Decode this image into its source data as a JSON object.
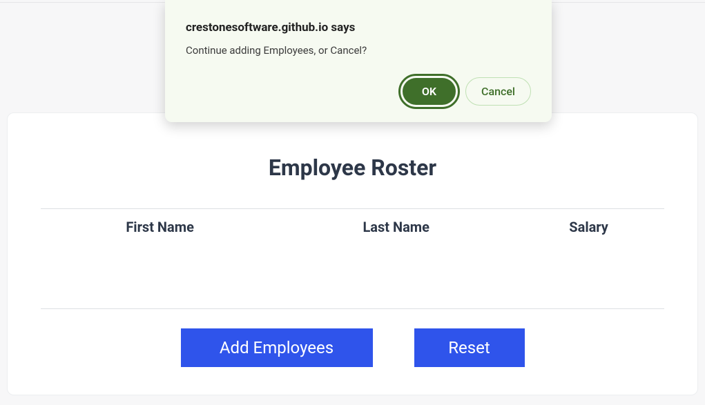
{
  "dialog": {
    "title": "crestonesoftware.github.io says",
    "message": "Continue adding Employees, or Cancel?",
    "ok_label": "OK",
    "cancel_label": "Cancel"
  },
  "card": {
    "title": "Employee Roster",
    "columns": {
      "first_name": "First Name",
      "last_name": "Last Name",
      "salary": "Salary"
    },
    "buttons": {
      "add": "Add Employees",
      "reset": "Reset"
    }
  }
}
